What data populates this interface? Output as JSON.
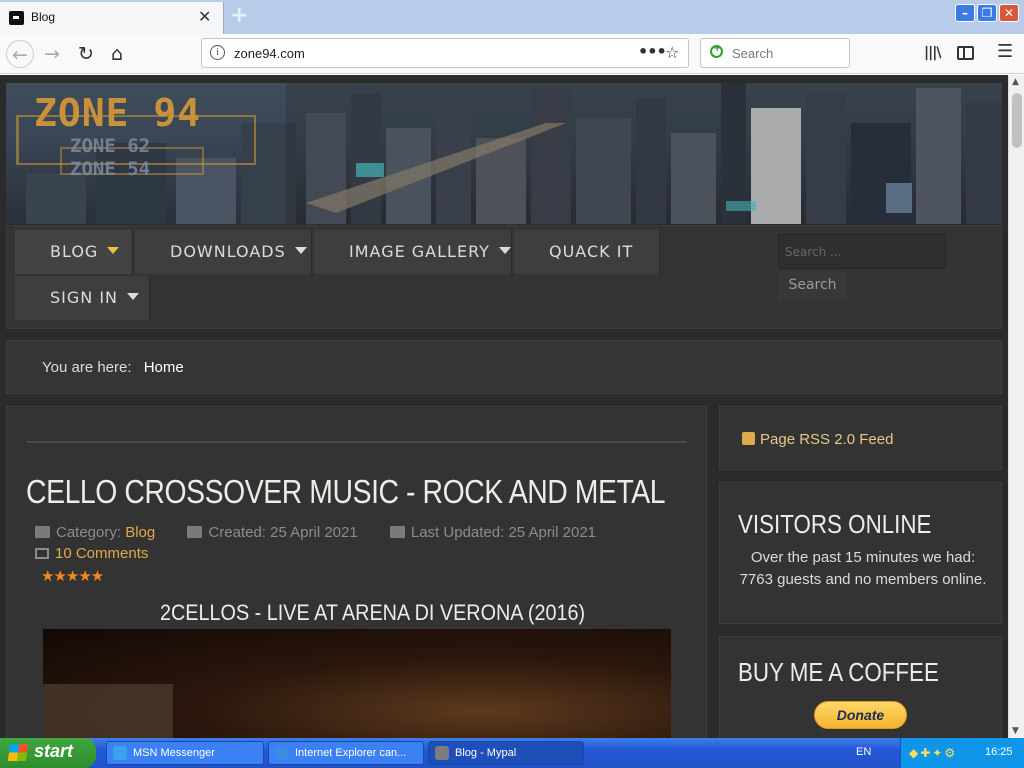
{
  "browser": {
    "tab_title": "Blog",
    "tab_close": "✕",
    "new_tab": "+",
    "url": "zone94.com",
    "search_placeholder": "Search",
    "back": "←",
    "forward": "→",
    "reload": "↻",
    "home": "⌂",
    "page_actions": "•••",
    "bookmark": "☆",
    "library": "|||\\",
    "menu": "☰",
    "window_min": "–",
    "window_max": "❐",
    "window_close": "✕"
  },
  "site": {
    "logo_main": "ZONE 94",
    "logo_sub1": "ZONE 62",
    "logo_sub2": "ZONE 54",
    "menu": {
      "blog": "BLOG",
      "downloads": "DOWNLOADS",
      "gallery": "IMAGE GALLERY",
      "quack": "QUACK IT",
      "signin": "SIGN IN"
    },
    "search_placeholder": "Search ...",
    "search_button": "Search",
    "breadcrumb_label": "You are here:",
    "breadcrumb_home": "Home"
  },
  "article": {
    "title": "CELLO CROSSOVER MUSIC - ROCK AND METAL",
    "category_label": "Category:",
    "category": "Blog",
    "created": "Created: 25 April 2021",
    "updated": "Last Updated: 25 April 2021",
    "comments": "10 Comments",
    "rating_stars": "★★★★★",
    "rating": 5,
    "video_title": "2CELLOS - LIVE AT ARENA DI VERONA (2016)"
  },
  "sidebar": {
    "rss": "Page RSS 2.0 Feed",
    "visitors_title": "VISITORS ONLINE",
    "visitors_text": "Over the past 15 minutes we had: 7763 guests and no members online.",
    "coffee_title": "BUY ME A COFFEE",
    "donate": "Donate"
  },
  "taskbar": {
    "start": "start",
    "tasks": [
      {
        "label": "MSN Messenger"
      },
      {
        "label": "Internet Explorer can..."
      },
      {
        "label": "Blog - Mypal"
      }
    ],
    "lang": "EN",
    "clock": "16:25"
  },
  "colors": {
    "accent": "#e0a94a",
    "page_bg": "#2b2b2b",
    "panel_bg": "#333333"
  }
}
